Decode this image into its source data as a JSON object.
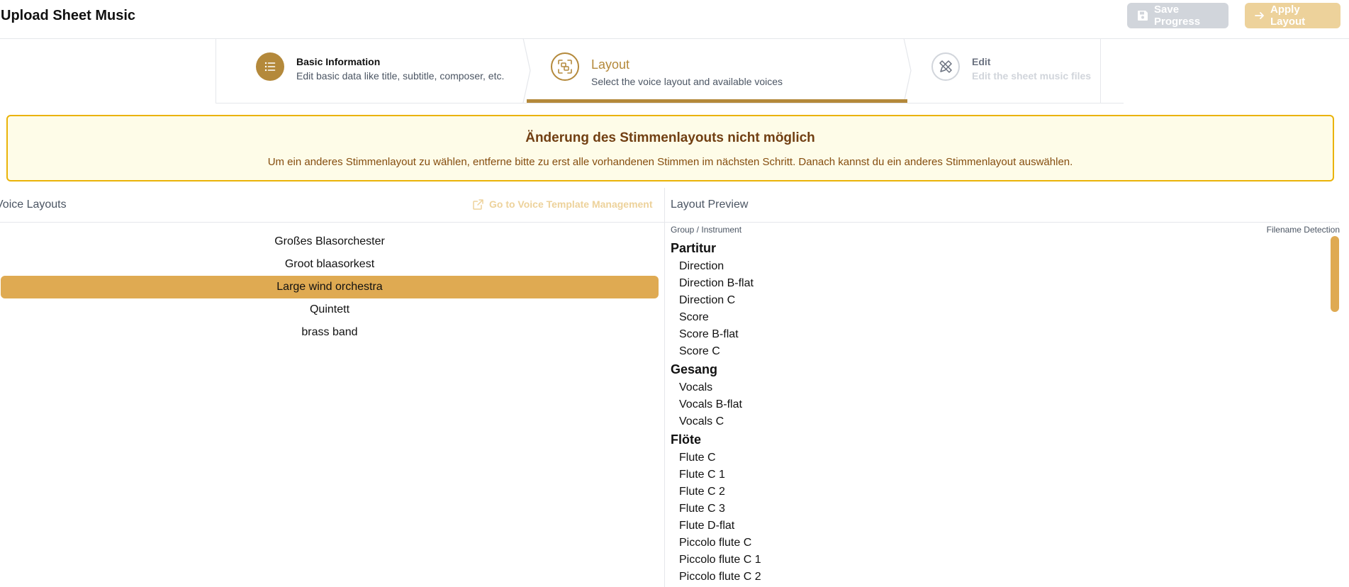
{
  "header": {
    "title": "Upload Sheet Music",
    "save_label": "Save Progress",
    "apply_label": "Apply Layout",
    "colors": {
      "save_bg": "#d1d5db",
      "apply_bg": "#edd29b"
    }
  },
  "stepper": {
    "steps": [
      {
        "title": "Basic Information",
        "subtitle": "Edit basic data like title, subtitle, composer, etc.",
        "icon": "list-icon",
        "state": "completed"
      },
      {
        "title": "Layout",
        "subtitle": "Select the voice layout and available voices",
        "icon": "layout-scan-icon",
        "state": "active"
      },
      {
        "title": "Edit",
        "subtitle": "Edit the sheet music files",
        "icon": "pencil-ruler-icon",
        "state": "upcoming"
      }
    ],
    "accent": "#b4893b"
  },
  "warning": {
    "title": "Änderung des Stimmenlayouts nicht möglich",
    "text": "Um ein anderes Stimmenlayout zu wählen, entferne bitte zu erst alle vorhandenen Stimmen im nächsten Schritt. Danach kannst du ein anderes Stimmenlayout auswählen."
  },
  "left_panel": {
    "title": "Voice Layouts",
    "link_label": "Go to Voice Template Management",
    "link_icon": "external-link-icon",
    "layouts": [
      {
        "label": "Großes Blasorchester",
        "selected": false
      },
      {
        "label": "Groot blaasorkest",
        "selected": false
      },
      {
        "label": "Large wind orchestra",
        "selected": true
      },
      {
        "label": "Quintett",
        "selected": false
      },
      {
        "label": "brass band",
        "selected": false
      }
    ]
  },
  "right_panel": {
    "title": "Layout Preview",
    "col_left": "Group / Instrument",
    "col_right": "Filename Detection",
    "groups": [
      {
        "name": "Partitur",
        "voices": [
          "Direction",
          "Direction B-flat",
          "Direction C",
          "Score",
          "Score B-flat",
          "Score C"
        ]
      },
      {
        "name": "Gesang",
        "voices": [
          "Vocals",
          "Vocals B-flat",
          "Vocals C"
        ]
      },
      {
        "name": "Flöte",
        "voices": [
          "Flute C",
          "Flute C 1",
          "Flute C 2",
          "Flute C 3",
          "Flute D-flat",
          "Piccolo flute C",
          "Piccolo flute C 1",
          "Piccolo flute C 2"
        ]
      }
    ]
  }
}
